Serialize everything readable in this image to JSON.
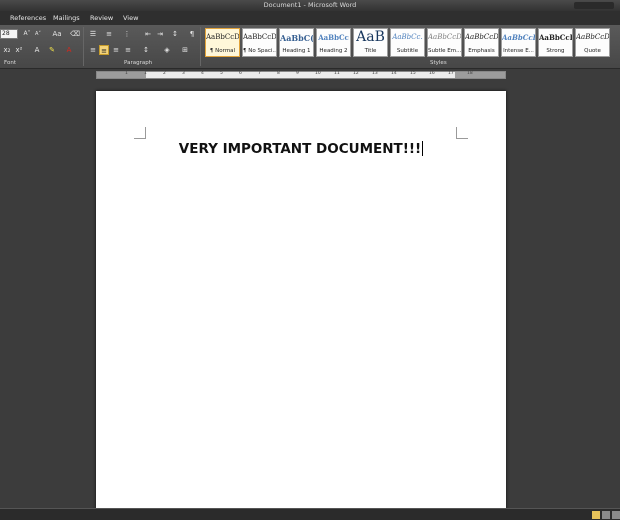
{
  "window": {
    "title": "Document1 - Microsoft Word"
  },
  "tabs": [
    {
      "label": "References"
    },
    {
      "label": "Mailings"
    },
    {
      "label": "Review"
    },
    {
      "label": "View"
    }
  ],
  "ribbon": {
    "font": {
      "size": "28",
      "group_label": "Font",
      "grow_label": "A",
      "shrink_label": "A",
      "font_color_label": "A"
    },
    "paragraph": {
      "group_label": "Paragraph"
    },
    "styles": {
      "group_label": "Styles",
      "tiles": [
        {
          "sample": "AaBbCcDc",
          "name": "¶ Normal",
          "selected": true
        },
        {
          "sample": "AaBbCcDc",
          "name": "¶ No Spaci..."
        },
        {
          "sample": "AaBbC(",
          "name": "Heading 1"
        },
        {
          "sample": "AaBbCc",
          "name": "Heading 2"
        },
        {
          "sample": "AaB",
          "name": "Title"
        },
        {
          "sample": "AaBbCc.",
          "name": "Subtitle"
        },
        {
          "sample": "AaBbCcDt",
          "name": "Subtle Em..."
        },
        {
          "sample": "AaBbCcDt",
          "name": "Emphasis"
        },
        {
          "sample": "AaBbCcDt",
          "name": "Intense E..."
        },
        {
          "sample": "AaBbCcDc",
          "name": "Strong"
        },
        {
          "sample": "AaBbCcDc",
          "name": "Quote"
        }
      ]
    }
  },
  "ruler": {
    "numbers": [
      "1",
      "1",
      "2",
      "3",
      "4",
      "5",
      "6",
      "7",
      "8",
      "9",
      "10",
      "11",
      "12",
      "13",
      "14",
      "15",
      "16",
      "17",
      "18"
    ]
  },
  "document": {
    "text": "VERY IMPORTANT DOCUMENT!!!"
  },
  "colors": {
    "accent_highlight": "#f3d37a",
    "font_color_red": "#d9271c",
    "style_selected": "#e2a33a"
  }
}
